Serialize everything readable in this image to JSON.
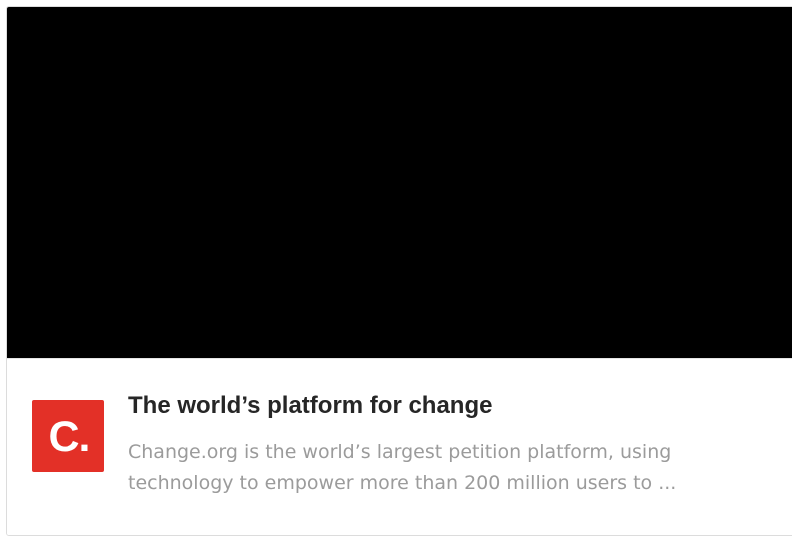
{
  "link_preview": {
    "logo_text": "C.",
    "logo_color": "#e33027",
    "title": "The world’s platform for change",
    "description": "Change.org is the world’s largest petition platform, using technology to empower more than 200 million users to ..."
  }
}
